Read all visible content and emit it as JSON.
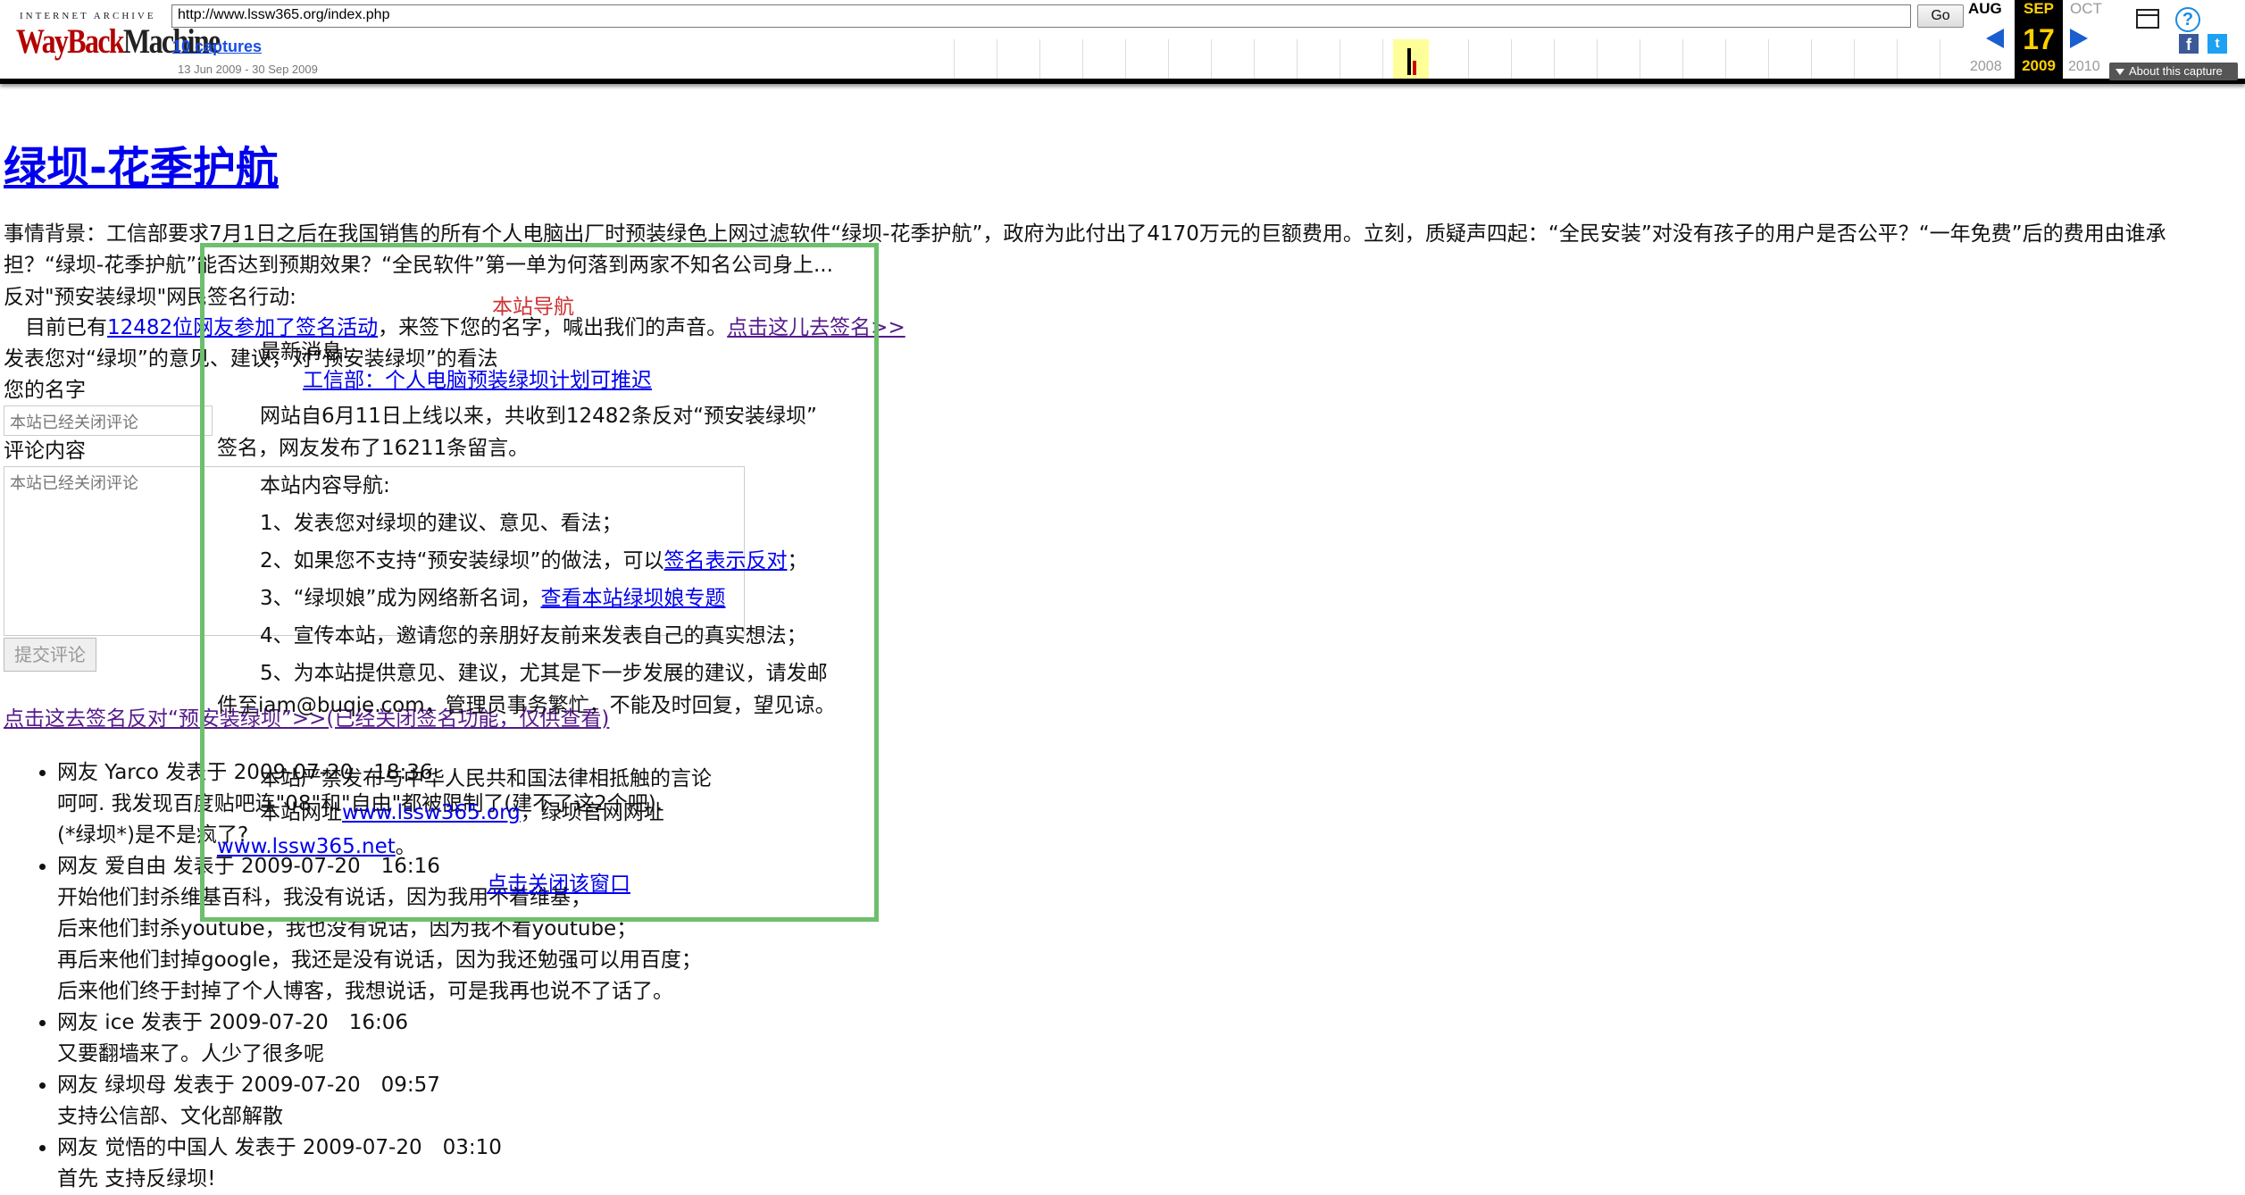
{
  "wayback": {
    "logo_top": "INTERNET ARCHIVE",
    "logo_word1": "WayBack",
    "logo_word2": "Machine",
    "url": "http://www.lssw365.org/index.php",
    "go": "Go",
    "captures": "10 captures",
    "date_range": "13 Jun 2009 - 30 Sep 2009",
    "prev_month": "AUG",
    "cur_month": "SEP",
    "next_month": "OCT",
    "cur_day": "17",
    "prev_year": "2008",
    "cur_year": "2009",
    "next_year": "2010",
    "about": "About this capture"
  },
  "page": {
    "title": "绿坝-花季护航",
    "background": "事情背景：工信部要求7月1日之后在我国销售的所有个人电脑出厂时预装绿色上网过滤软件“绿坝-花季护航”，政府为此付出了4170万元的巨额费用。立刻，质疑声四起：“全民安装”对没有孩子的用户是否公平？“一年免费”后的费用由谁承担？“绿坝-花季护航”能否达到预期效果？“全民软件”第一单为何落到两家不知名公司身上...",
    "petition_heading": "反对\"预安装绿坝\"网民签名行动:",
    "signed_prefix": "目前已有",
    "signed_link": "12482位网友参加了签名活动",
    "signed_mid": "，来签下您的名字，喊出我们的声音。",
    "sign_here_link": "点击这儿去签名>>",
    "opinion_heading": "发表您对“绿坝”的意见、建议，对“预安装绿坝”的看法",
    "name_label": "您的名字",
    "name_placeholder": "本站已经关闭评论",
    "comment_label": "评论内容",
    "comment_placeholder": "本站已经关闭评论",
    "submit": "提交评论",
    "sign_closed_link": "点击这去签名反对“预安装绿坝”>>(已经关闭签名功能，仅供查看)"
  },
  "comments": [
    {
      "lines": [
        "网友 Yarco 发表于 2009-07-20　18:36",
        "呵呵. 我发现百度贴吧连\"08\"和\"自由\"都被限制了(建不了这2个吧).",
        "(*绿坝*)是不是疯了?"
      ]
    },
    {
      "lines": [
        "网友 爱自由 发表于 2009-07-20　16:16",
        "开始他们封杀维基百科，我没有说话，因为我用不着维基；",
        "后来他们封杀youtube，我也没有说话，因为我不看youtube；",
        "再后来他们封掉google，我还是没有说话，因为我还勉强可以用百度；",
        "后来他们终于封掉了个人博客，我想说话，可是我再也说不了话了。"
      ]
    },
    {
      "lines": [
        "网友 ice 发表于 2009-07-20　16:06",
        "又要翻墙来了。人少了很多呢"
      ]
    },
    {
      "lines": [
        "网友 绿坝母 发表于 2009-07-20　09:57",
        "支持公信部、文化部解散"
      ]
    },
    {
      "lines": [
        "网友 觉悟的中国人 发表于 2009-07-20　03:10",
        "首先 支持反绿坝!"
      ]
    }
  ],
  "overlay": {
    "title": "本站导航",
    "latest_label": "最新消息:",
    "latest_link": "工信部：个人电脑预装绿坝计划可推迟",
    "stats_1": "网站自6月11日上线以来，共收到12482条反对“预安装绿坝”",
    "stats_2": "签名，网友发布了16211条留言。",
    "nav_label": "本站内容导航:",
    "nav_1": "1、发表您对绿坝的建议、意见、看法；",
    "nav_2_prefix": "2、如果您不支持“预安装绿坝”的做法，可以",
    "nav_2_link": "签名表示反对",
    "nav_2_suffix": "；",
    "nav_3_prefix": "3、“绿坝娘”成为网络新名词，",
    "nav_3_link": "查看本站绿坝娘专题",
    "nav_4": "4、宣传本站，邀请您的亲朋好友前来发表自己的真实想法；",
    "nav_5_1": "5、为本站提供意见、建议，尤其是下一步发展的建议，请发邮",
    "nav_5_2": "件至iam@buqie.com，管理员事务繁忙，不能及时回复，望见谅。",
    "notice": "本站严禁发布与中华人民共和国法律相抵触的言论",
    "site_prefix": "本站网址",
    "site_link_1": "www.lssw365.org",
    "site_mid": "，绿坝官网网址",
    "site_link_2": "www.lssw365.net",
    "site_suffix": "。",
    "close_link": "点击关闭该窗口"
  }
}
